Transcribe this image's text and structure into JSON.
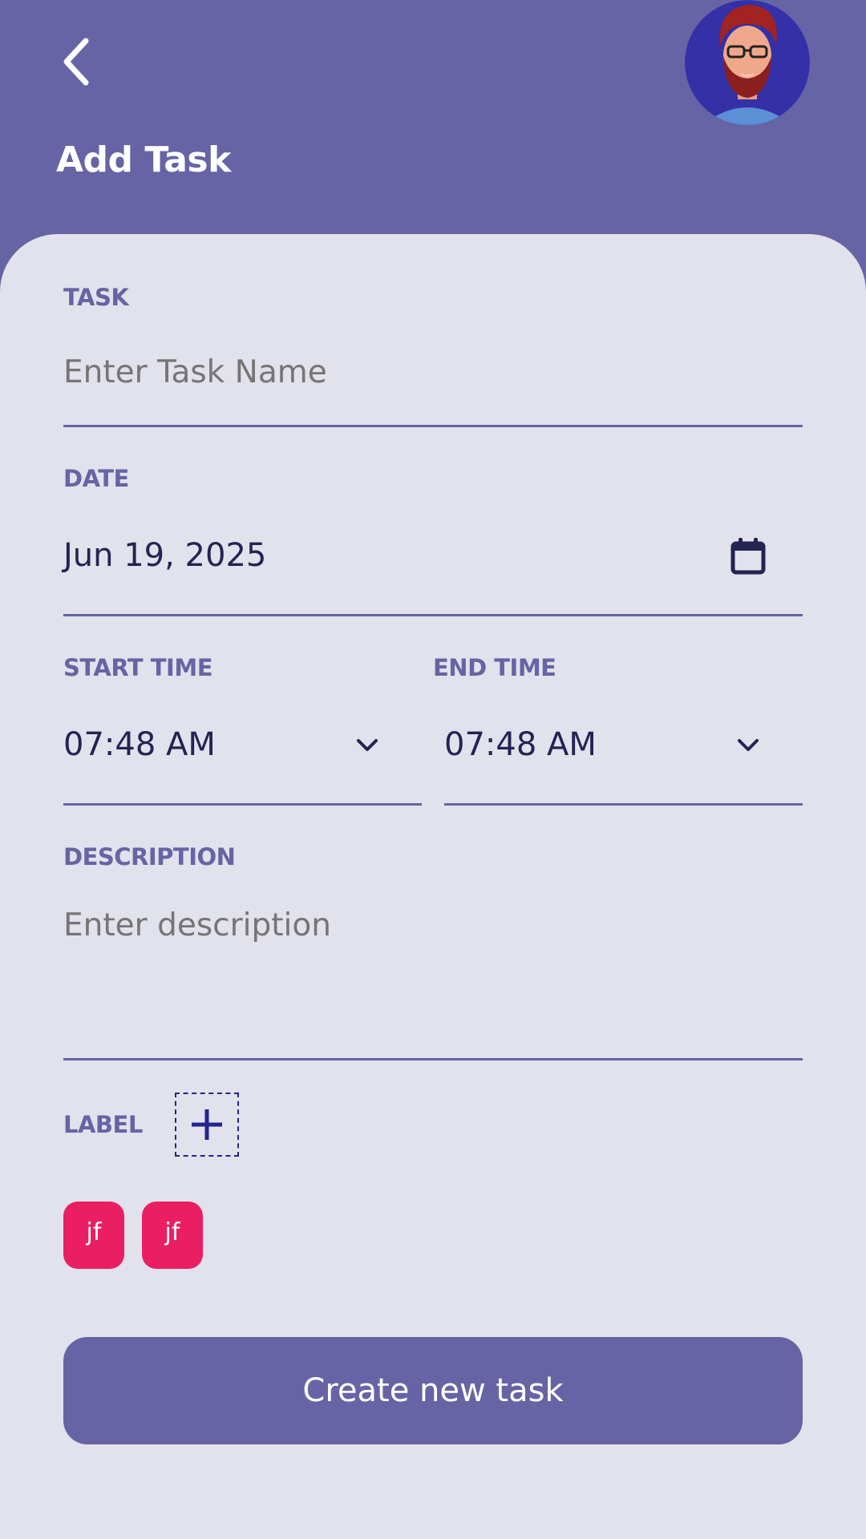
{
  "header": {
    "title": "Add Task",
    "back_icon": "chevron-left-icon",
    "avatar_icon": "user-avatar"
  },
  "form": {
    "task": {
      "label": "TASK",
      "placeholder": "Enter Task Name",
      "value": ""
    },
    "date": {
      "label": "DATE",
      "value": "Jun 19, 2025",
      "icon": "calendar-icon"
    },
    "start_time": {
      "label": "START TIME",
      "value": "07:48 AM",
      "icon": "chevron-down-icon"
    },
    "end_time": {
      "label": "END TIME",
      "value": "07:48 AM",
      "icon": "chevron-down-icon"
    },
    "description": {
      "label": "DESCRIPTION",
      "placeholder": "Enter description",
      "value": ""
    },
    "labels": {
      "label": "LABEL",
      "add_icon": "plus-icon",
      "chips": [
        "jf",
        "jf"
      ]
    }
  },
  "actions": {
    "submit_label": "Create new task"
  },
  "colors": {
    "primary": "#6664a4",
    "surface": "#e1e2eb",
    "chip": "#ea1e63",
    "text_dark": "#232354"
  }
}
